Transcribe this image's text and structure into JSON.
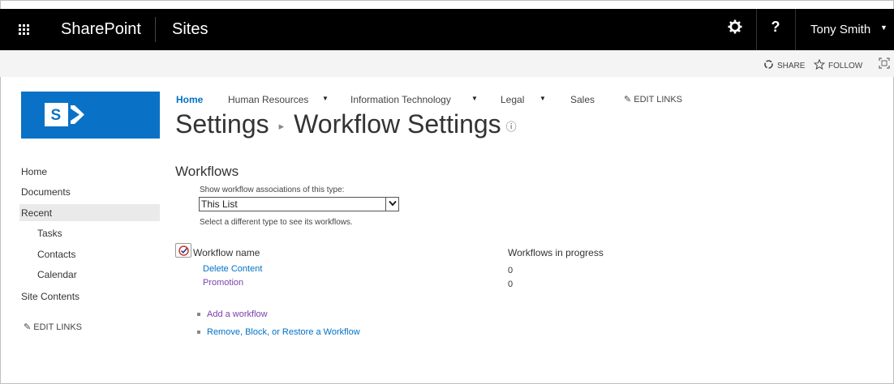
{
  "suite_bar": {
    "app_name": "SharePoint",
    "section": "Sites",
    "help_label": "?",
    "user_name": "Tony Smith"
  },
  "action_bar": {
    "share_label": "SHARE",
    "follow_label": "FOLLOW"
  },
  "top_nav": {
    "items": [
      {
        "label": "Home",
        "has_menu": false
      },
      {
        "label": "Human Resources",
        "has_menu": true
      },
      {
        "label": "Information Technology",
        "has_menu": true
      },
      {
        "label": "Legal",
        "has_menu": true
      },
      {
        "label": "Sales",
        "has_menu": false
      }
    ],
    "edit_links_label": "EDIT LINKS"
  },
  "page_title": {
    "parent": "Settings",
    "current": "Workflow Settings"
  },
  "left_nav": {
    "items": [
      {
        "label": "Home"
      },
      {
        "label": "Documents"
      },
      {
        "label": "Recent",
        "selected": true
      },
      {
        "label": "Tasks"
      },
      {
        "label": "Contacts"
      },
      {
        "label": "Calendar"
      },
      {
        "label": "Site Contents"
      }
    ],
    "edit_links_label": "EDIT LINKS"
  },
  "workflows": {
    "section_title": "Workflows",
    "filter_label": "Show workflow associations of this type:",
    "filter_value": "This List",
    "hint": "Select a different type to see its workflows.",
    "columns": [
      "Workflow name",
      "Workflows in progress"
    ],
    "rows": [
      {
        "name": "Delete Content",
        "in_progress": "0"
      },
      {
        "name": "Promotion",
        "in_progress": "0"
      }
    ],
    "actions": [
      {
        "label": "Add a workflow"
      },
      {
        "label": "Remove, Block, or Restore a Workflow"
      }
    ]
  },
  "colors": {
    "suite_bar_bg": "#000000",
    "accent_blue": "#0072c6",
    "logo_blue": "#0a72c6",
    "visited_link": "#7b3faa"
  }
}
